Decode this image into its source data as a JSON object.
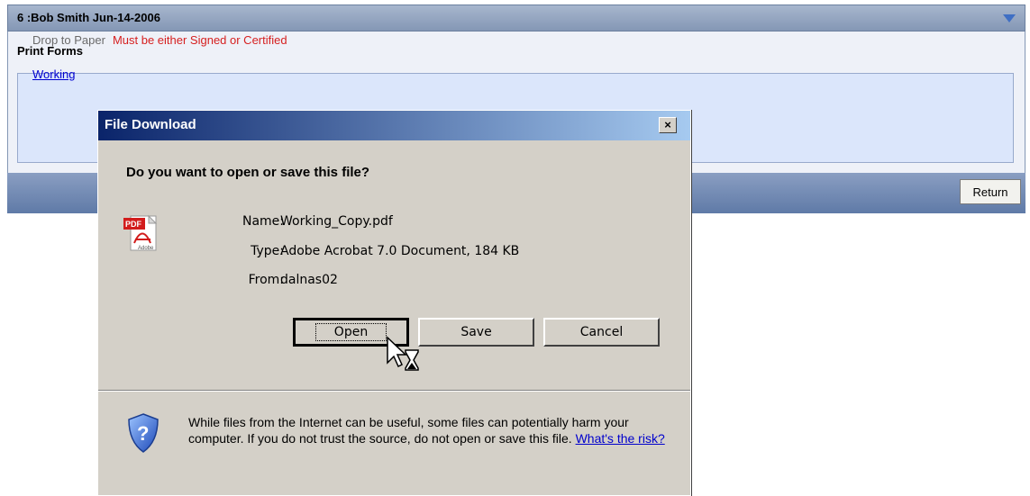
{
  "page": {
    "header_title": "6  :Bob Smith  Jun-14-2006",
    "section_title": "Print Forms",
    "drop_label": "Drop to Paper",
    "drop_warning": "Must be either Signed or Certified",
    "link_label": "Working",
    "return_label": "Return"
  },
  "dialog": {
    "title": "File Download",
    "close_label": "×",
    "question": "Do you want to open or save this file?",
    "name_label": "Name:",
    "name_value": "Working_Copy.pdf",
    "type_label": "Type:",
    "type_value": "Adobe Acrobat 7.0 Document, 184 KB",
    "from_label": "From:",
    "from_value": "dalnas02",
    "open_label": "Open",
    "save_label": "Save",
    "cancel_label": "Cancel",
    "warning_text": "While files from the Internet can be useful, some files can potentially harm your computer. If you do not trust the source, do not open or save this file.",
    "risk_link": "What's the risk?",
    "icons": {
      "file": "pdf-icon",
      "security": "shield-question-icon",
      "cursor": "busy-cursor-icon"
    },
    "pdf_badge": "PDF",
    "pdf_brand": "Adobe"
  }
}
